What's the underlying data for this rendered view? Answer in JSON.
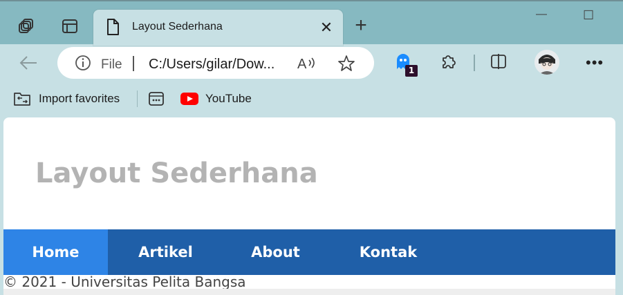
{
  "browser": {
    "tab": {
      "title": "Layout Sederhana"
    },
    "new_tab_symbol": "+",
    "window_controls": {
      "minimize": "—",
      "maximize": "☐"
    },
    "address_bar": {
      "scheme_label": "File",
      "separator": "|",
      "url": "C:/Users/gilar/Dow..."
    },
    "extension_badge": "1",
    "more_symbol": "•••",
    "favorites": [
      {
        "label": "Import favorites",
        "icon": "import-favorites-icon"
      },
      {
        "label": "",
        "icon": "apps-icon"
      },
      {
        "label": "YouTube",
        "icon": "youtube-icon"
      }
    ]
  },
  "page": {
    "title": "Layout Sederhana",
    "nav": [
      {
        "label": "Home",
        "active": true
      },
      {
        "label": "Artikel",
        "active": false
      },
      {
        "label": "About",
        "active": false
      },
      {
        "label": "Kontak",
        "active": false
      }
    ],
    "footer": "© 2021 - Universitas Pelita Bangsa"
  },
  "colors": {
    "nav_bg": "#1f5fa8",
    "nav_active": "#2e84e6",
    "title_color": "#b3b3b3",
    "browser_frame": "#c7e0e4",
    "tab_strip": "#86b9c1"
  }
}
